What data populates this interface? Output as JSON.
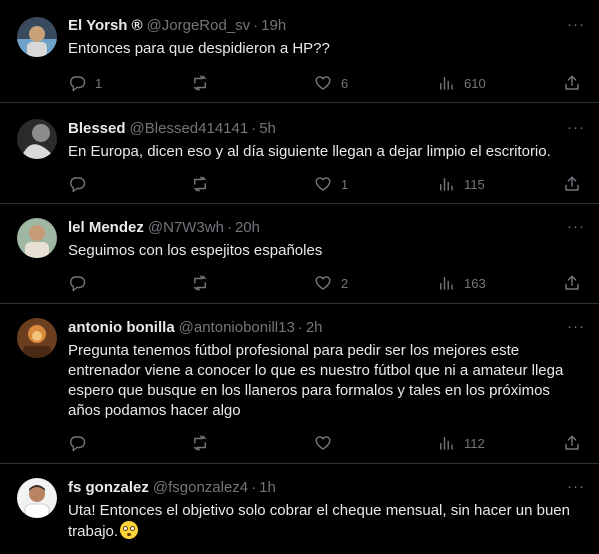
{
  "colors": {
    "background": "#000000",
    "text": "#e7e9ea",
    "muted": "#71767b",
    "divider": "#2f3336"
  },
  "replies": [
    {
      "name": "El Yorsh",
      "badge": "®",
      "handle": "@JorgeRod_sv",
      "time": "19h",
      "text": "Entonces para que despidieron a HP??",
      "emoji": "",
      "replies": "1",
      "reposts": "",
      "likes": "6",
      "views": "610",
      "avatar_colors": [
        "#3a4a5e",
        "#c9a27a",
        "#6fa3c9"
      ]
    },
    {
      "name": "Blessed",
      "badge": "",
      "handle": "@Blessed414141",
      "time": "5h",
      "text": "En Europa, dicen eso y al día siguiente llegan a dejar limpio el escritorio.",
      "emoji": "",
      "replies": "",
      "reposts": "",
      "likes": "1",
      "views": "115",
      "avatar_colors": [
        "#2b2b2b",
        "#8c8c8c",
        "#d9d9d9"
      ]
    },
    {
      "name": "lel Mendez",
      "badge": "",
      "handle": "@N7W3wh",
      "time": "20h",
      "text": "Seguimos con los espejitos españoles",
      "emoji": "",
      "replies": "",
      "reposts": "",
      "likes": "2",
      "views": "163",
      "avatar_colors": [
        "#9fb7a3",
        "#c69a74",
        "#e8e0d2"
      ]
    },
    {
      "name": "antonio bonilla",
      "badge": "",
      "handle": "@antoniobonill13",
      "time": "2h",
      "text": "Pregunta tenemos fútbol profesional para pedir ser los mejores este entrenador viene a conocer  lo que es nuestro fútbol que ni a amateur llega espero que busque en los llaneros para formalos y tales en los próximos años podamos hacer algo",
      "emoji": "",
      "replies": "",
      "reposts": "",
      "likes": "",
      "views": "112",
      "avatar_colors": [
        "#6b3e1f",
        "#d98a3c",
        "#f2c27a"
      ]
    },
    {
      "name": "fs gonzalez",
      "badge": "",
      "handle": "@fsgonzalez4",
      "time": "1h",
      "text": "Uta! Entonces el objetivo solo cobrar el cheque mensual, sin hacer un buen trabajo.",
      "emoji": "face-with-rolling-eyes",
      "replies": "",
      "reposts": "",
      "likes": "",
      "views": "",
      "avatar_colors": [
        "#f2f2f2",
        "#b88462",
        "#3a2a22"
      ]
    }
  ],
  "icons": {
    "reply": "reply-icon",
    "repost": "repost-icon",
    "like": "like-icon",
    "views": "views-icon",
    "share": "share-icon",
    "more": "more-icon"
  },
  "more_glyph": "···"
}
